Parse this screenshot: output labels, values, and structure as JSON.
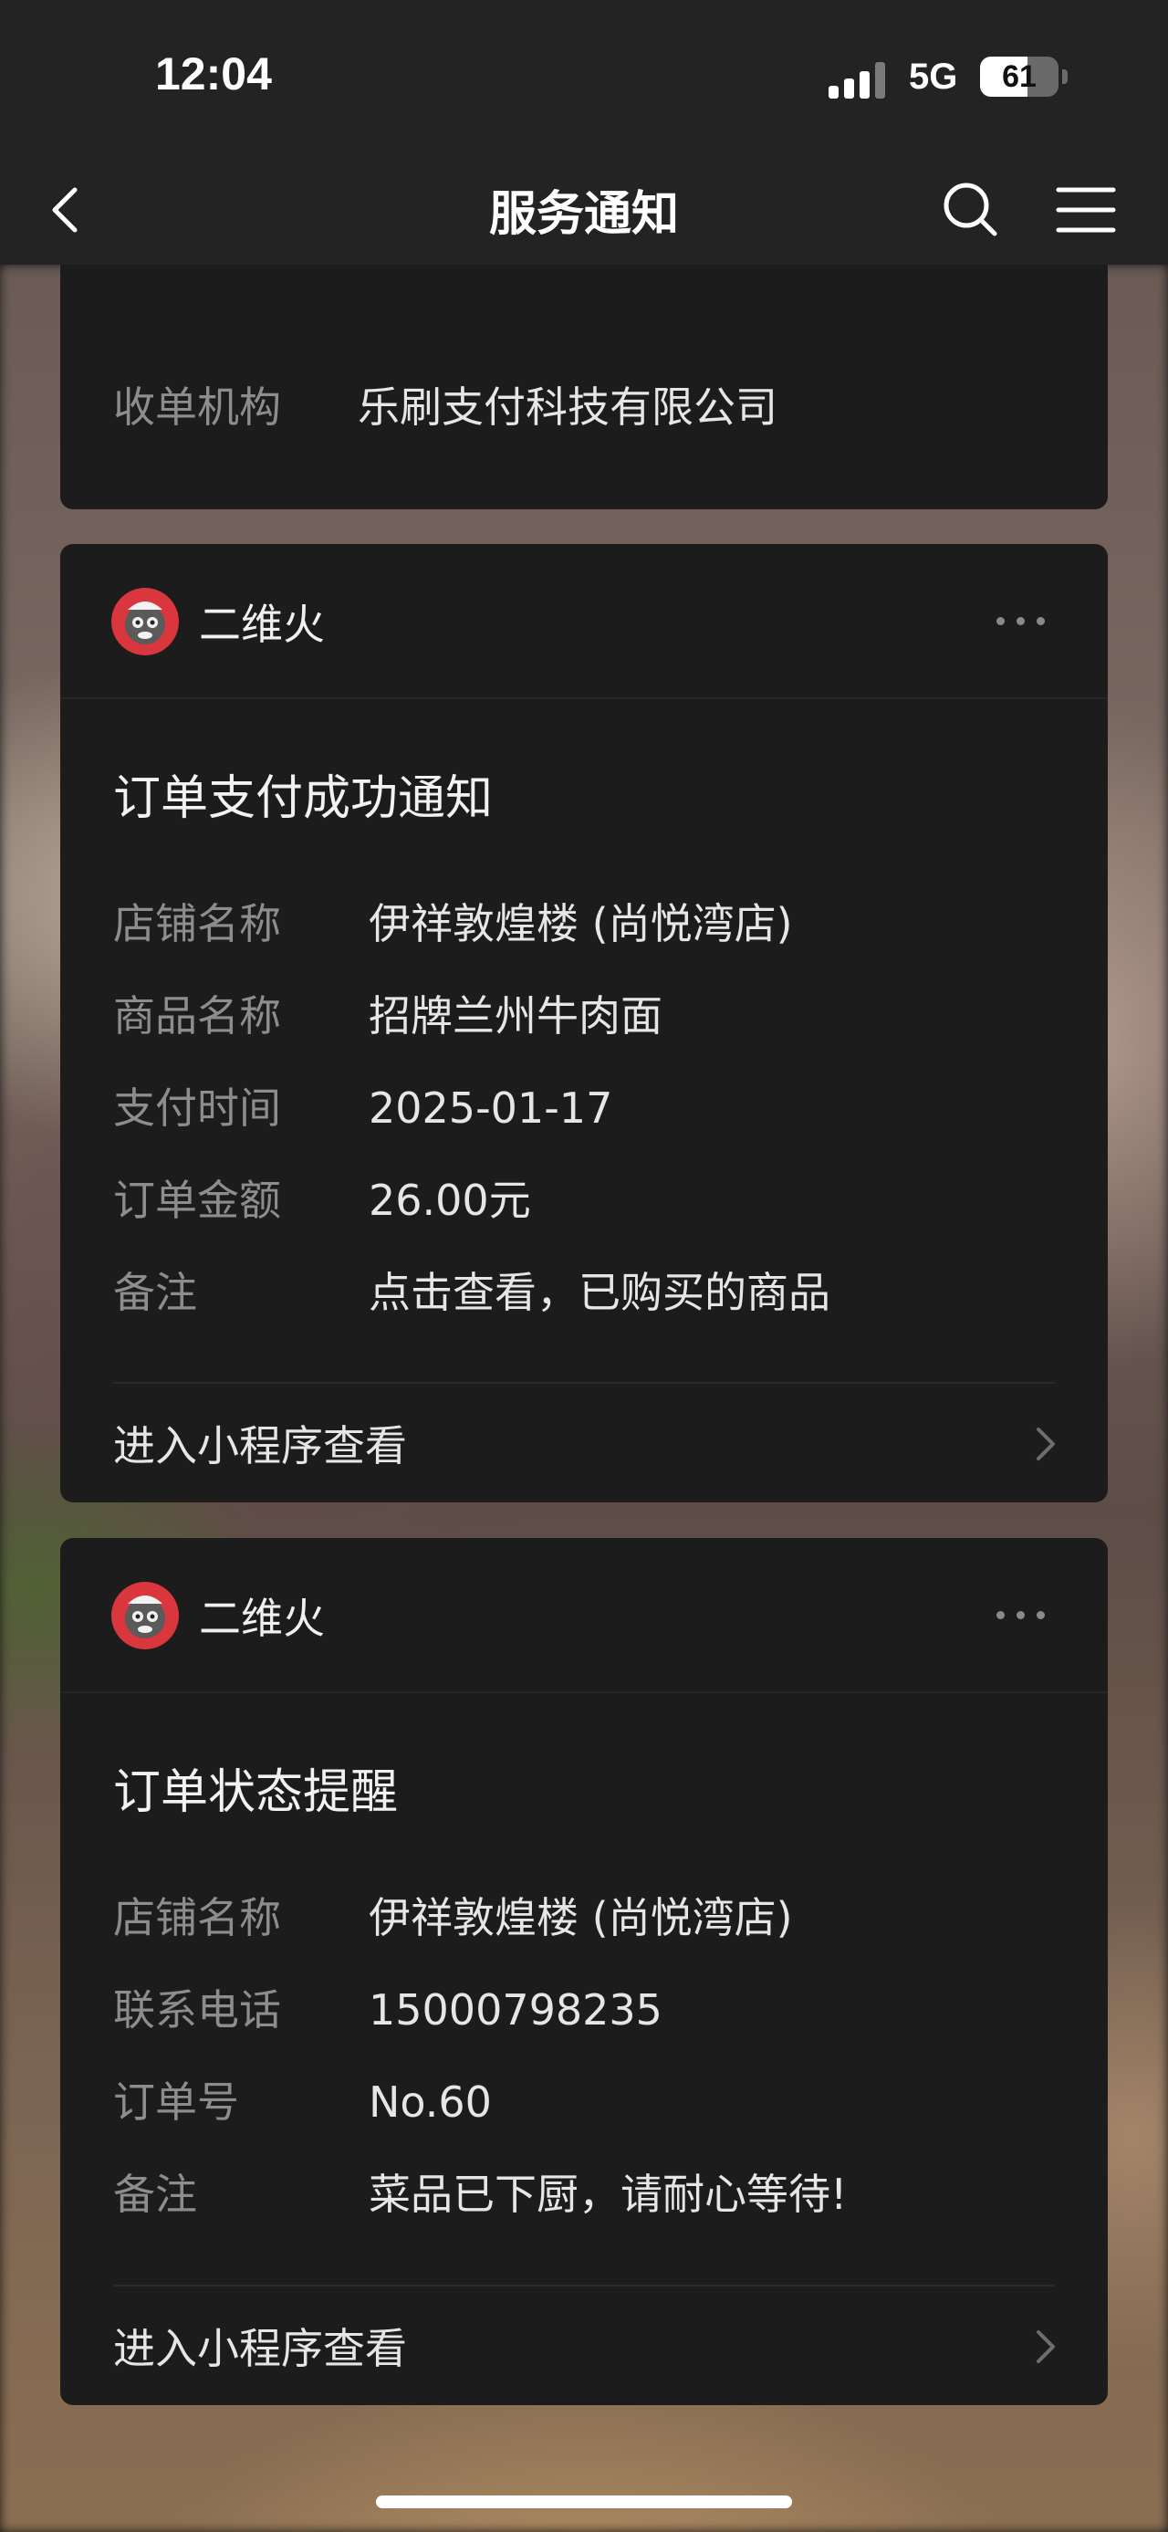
{
  "status_bar": {
    "time": "12:04",
    "network": "5G",
    "battery": "61",
    "battery_level": 0.61
  },
  "nav": {
    "title": "服务通知",
    "icons": [
      "chevron-left-icon",
      "search-icon",
      "menu-icon"
    ]
  },
  "partial_card": {
    "label": "收单机构",
    "value": "乐刷支付科技有限公司"
  },
  "cards": [
    {
      "org": "二维火",
      "title": "订单支付成功通知",
      "rows": [
        {
          "k": "店铺名称",
          "v": "伊祥敦煌楼 (尚悦湾店)"
        },
        {
          "k": "商品名称",
          "v": "招牌兰州牛肉面"
        },
        {
          "k": "支付时间",
          "v": "2025-01-17"
        },
        {
          "k": "订单金额",
          "v": "26.00元"
        },
        {
          "k": "备注",
          "v": "点击查看，已购买的商品"
        }
      ],
      "action": "进入小程序查看"
    },
    {
      "org": "二维火",
      "title": "订单状态提醒",
      "rows": [
        {
          "k": "店铺名称",
          "v": "伊祥敦煌楼 (尚悦湾店)"
        },
        {
          "k": "联系电话",
          "v": "15000798235"
        },
        {
          "k": "订单号",
          "v": "No.60"
        },
        {
          "k": "备注",
          "v": "菜品已下厨，请耐心等待!"
        }
      ],
      "action": "进入小程序查看"
    }
  ],
  "colors": {
    "card_bg": "#1c1c1c",
    "bar_bg": "#232323",
    "label_gray": "#8d8d8d",
    "avatar_red": "#d9363e"
  }
}
